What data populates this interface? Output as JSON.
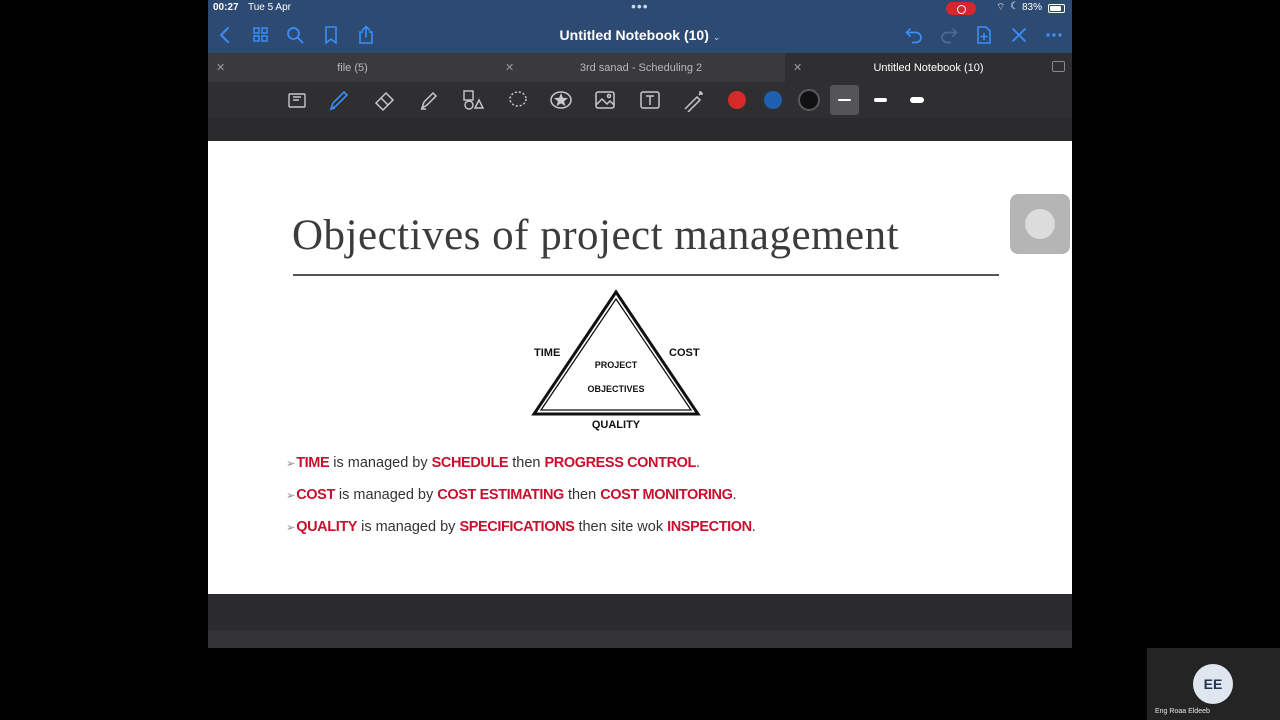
{
  "status_bar": {
    "time": "00:27",
    "date": "Tue 5 Apr",
    "battery": "83%"
  },
  "title_bar": {
    "title": "Untitled Notebook (10)",
    "icons": [
      "back-icon",
      "grid-icon",
      "search-icon",
      "bookmark-icon",
      "share-icon",
      "undo-icon",
      "redo-icon",
      "add-page-icon",
      "close-icon",
      "more-icon"
    ]
  },
  "tabs": [
    {
      "label": "file (5)",
      "active": false
    },
    {
      "label": "3rd sanad - Scheduling 2",
      "active": false
    },
    {
      "label": "Untitled Notebook (10)",
      "active": true
    }
  ],
  "toolbar": {
    "tools": [
      "scan-icon",
      "pen-icon",
      "eraser-icon",
      "highlighter-icon",
      "shapes-icon",
      "lasso-icon",
      "sticker-icon",
      "image-icon",
      "text-icon",
      "laser-pointer-icon"
    ],
    "colors": [
      "#d42a2a",
      "#1f5fb0",
      "#111111"
    ]
  },
  "slide": {
    "title": "Objectives of project management",
    "diagram": {
      "left_label": "TIME",
      "right_label": "COST",
      "bottom_label": "QUALITY",
      "center_line1": "PROJECT",
      "center_line2": "OBJECTIVES"
    },
    "bullets": [
      {
        "k1": "TIME",
        "t1": " is managed by ",
        "k2": "SCHEDULE",
        "t2": " then ",
        "k3": "PROGRESS CONTROL",
        "end": "."
      },
      {
        "k1": "COST",
        "t1": " is managed by ",
        "k2": "COST ESTIMATING",
        "t2": " then ",
        "k3": "COST MONITORING",
        "end": "."
      },
      {
        "k1": "QUALITY",
        "t1": " is managed by ",
        "k2": "SPECIFICATIONS",
        "t2": " then site wok ",
        "k3": "INSPECTION",
        "end": "."
      }
    ]
  },
  "participant": {
    "initials": "EE",
    "name": "Eng Roaa Eldeeb"
  }
}
